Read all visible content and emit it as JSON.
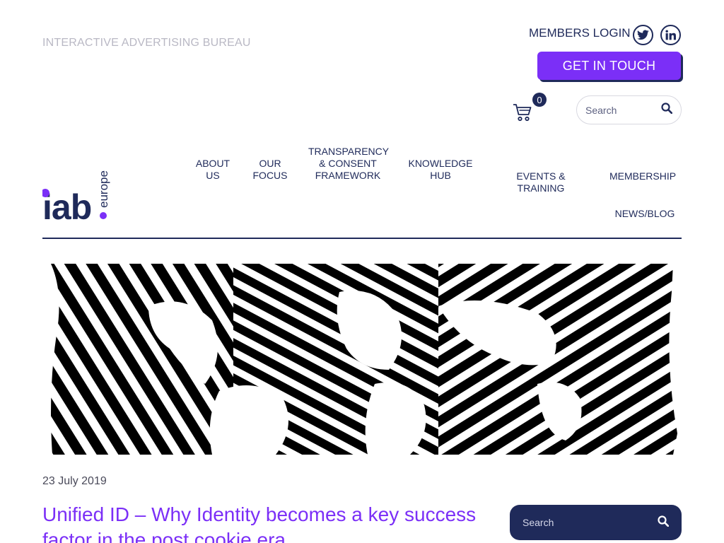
{
  "header": {
    "tagline": "INTERACTIVE ADVERTISING BUREAU",
    "members_login": "MEMBERS LOGIN",
    "cta_label": "GET IN TOUCH",
    "cart_count": "0",
    "search_placeholder": "Search",
    "social_icons": [
      "twitter-icon",
      "linkedin-icon"
    ]
  },
  "logo": {
    "text": "iab",
    "subtext": "europe"
  },
  "nav": {
    "about": "ABOUT US",
    "about_1": "ABOUT",
    "about_2": "US",
    "focus_1": "OUR",
    "focus_2": "FOCUS",
    "tcf_1": "TRANSPARENCY",
    "tcf_2": "& CONSENT",
    "tcf_3": "FRAMEWORK",
    "kh_1": "KNOWLEDGE",
    "kh_2": "HUB",
    "events": "EVENTS & TRAINING",
    "membership": "MEMBERSHIP",
    "news": "NEWS/BLOG"
  },
  "article": {
    "date": "23 July 2019",
    "title": "Unified ID – Why Identity becomes a key success factor in the post cookie era"
  },
  "sidebar": {
    "search_placeholder": "Search"
  },
  "colors": {
    "navy": "#1f2a5a",
    "purple": "#7b2ff7",
    "tagline_grey": "#b9b8c4"
  }
}
